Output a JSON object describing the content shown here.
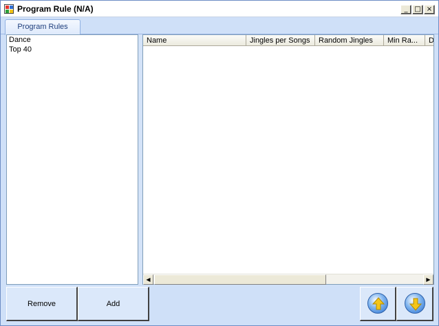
{
  "window": {
    "title": "Program Rule (N/A)",
    "min_glyph": "_",
    "max_glyph": "□",
    "close_glyph": "×"
  },
  "tabs": [
    {
      "label": "Program Rules",
      "selected": true
    }
  ],
  "rule_list": {
    "items": [
      "Dance",
      "Top 40"
    ]
  },
  "grid": {
    "columns": [
      "Name",
      "Jingles per Songs",
      "Random Jingles",
      "Min Ra...",
      "D"
    ],
    "rows": []
  },
  "scrollbar": {
    "left_glyph": "◀",
    "right_glyph": "▶"
  },
  "buttons": {
    "remove_label": "Remove",
    "add_label": "Add",
    "up_icon": "arrow-up-circle-icon",
    "down_icon": "arrow-down-circle-icon"
  },
  "colors": {
    "window_bg": "#cfe0f8",
    "tab_text": "#1f3f7c",
    "arrow_yellow": "#f5c518",
    "arrow_blue": "#2a6fd1"
  }
}
